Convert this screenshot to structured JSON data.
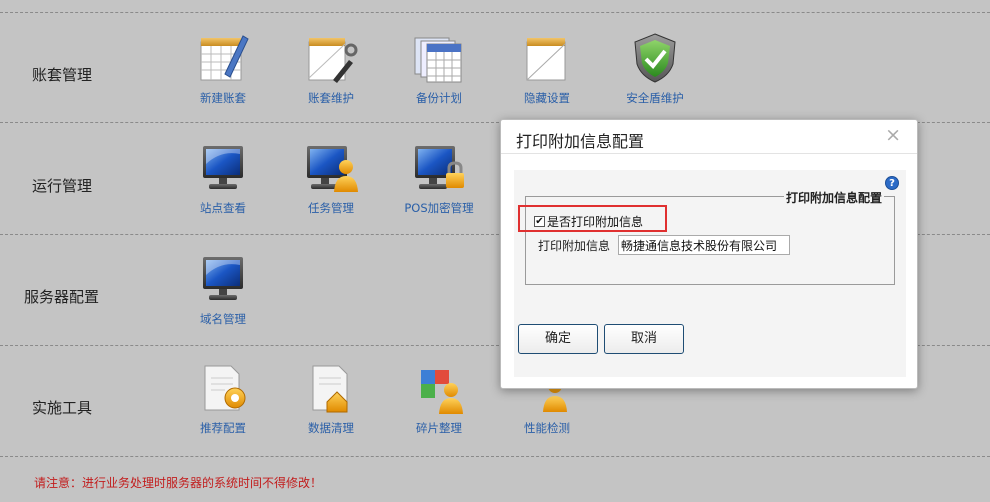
{
  "sections": [
    {
      "label": "账套管理",
      "items": [
        {
          "label": "新建账套",
          "icon": "notepad-pen-icon"
        },
        {
          "label": "账套维护",
          "icon": "notepad-tools-icon"
        },
        {
          "label": "备份计划",
          "icon": "calendar-stack-icon"
        },
        {
          "label": "隐藏设置",
          "icon": "notepad-blank-icon"
        },
        {
          "label": "安全盾维护",
          "icon": "shield-check-icon"
        }
      ]
    },
    {
      "label": "运行管理",
      "items": [
        {
          "label": "站点查看",
          "icon": "monitor-icon"
        },
        {
          "label": "任务管理",
          "icon": "monitor-user-icon"
        },
        {
          "label": "POS加密管理",
          "icon": "monitor-lock-icon"
        }
      ]
    },
    {
      "label": "服务器配置",
      "items": [
        {
          "label": "域名管理",
          "icon": "monitor-icon"
        }
      ]
    },
    {
      "label": "实施工具",
      "items": [
        {
          "label": "推荐配置",
          "icon": "document-gear-icon"
        },
        {
          "label": "数据清理",
          "icon": "document-home-icon"
        },
        {
          "label": "碎片整理",
          "icon": "puzzle-user-icon"
        },
        {
          "label": "性能检测",
          "icon": "user-icon"
        }
      ]
    }
  ],
  "notice": "请注意：进行业务处理时服务器的系统时间不得修改！",
  "dialog": {
    "title": "打印附加信息配置",
    "close": "×",
    "legend": "打印附加信息配置",
    "checkbox_label": "是否打印附加信息",
    "checkbox_checked": true,
    "info_label": "打印附加信息",
    "info_value": "畅捷通信息技术股份有限公司",
    "ok": "确定",
    "cancel": "取消"
  },
  "colors": {
    "background": "#c4c4c4",
    "link": "#2a5fa8",
    "notice": "#c21d1d",
    "highlight": "#e03030"
  }
}
